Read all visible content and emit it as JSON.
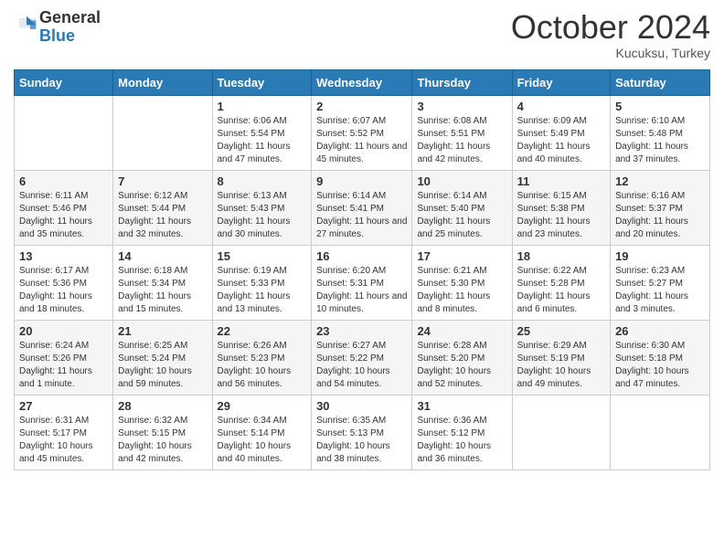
{
  "header": {
    "logo": {
      "general": "General",
      "blue": "Blue"
    },
    "title": "October 2024",
    "location": "Kucuksu, Turkey"
  },
  "weekdays": [
    "Sunday",
    "Monday",
    "Tuesday",
    "Wednesday",
    "Thursday",
    "Friday",
    "Saturday"
  ],
  "weeks": [
    [
      {
        "day": "",
        "sunrise": "",
        "sunset": "",
        "daylight": ""
      },
      {
        "day": "",
        "sunrise": "",
        "sunset": "",
        "daylight": ""
      },
      {
        "day": "1",
        "sunrise": "Sunrise: 6:06 AM",
        "sunset": "Sunset: 5:54 PM",
        "daylight": "Daylight: 11 hours and 47 minutes."
      },
      {
        "day": "2",
        "sunrise": "Sunrise: 6:07 AM",
        "sunset": "Sunset: 5:52 PM",
        "daylight": "Daylight: 11 hours and 45 minutes."
      },
      {
        "day": "3",
        "sunrise": "Sunrise: 6:08 AM",
        "sunset": "Sunset: 5:51 PM",
        "daylight": "Daylight: 11 hours and 42 minutes."
      },
      {
        "day": "4",
        "sunrise": "Sunrise: 6:09 AM",
        "sunset": "Sunset: 5:49 PM",
        "daylight": "Daylight: 11 hours and 40 minutes."
      },
      {
        "day": "5",
        "sunrise": "Sunrise: 6:10 AM",
        "sunset": "Sunset: 5:48 PM",
        "daylight": "Daylight: 11 hours and 37 minutes."
      }
    ],
    [
      {
        "day": "6",
        "sunrise": "Sunrise: 6:11 AM",
        "sunset": "Sunset: 5:46 PM",
        "daylight": "Daylight: 11 hours and 35 minutes."
      },
      {
        "day": "7",
        "sunrise": "Sunrise: 6:12 AM",
        "sunset": "Sunset: 5:44 PM",
        "daylight": "Daylight: 11 hours and 32 minutes."
      },
      {
        "day": "8",
        "sunrise": "Sunrise: 6:13 AM",
        "sunset": "Sunset: 5:43 PM",
        "daylight": "Daylight: 11 hours and 30 minutes."
      },
      {
        "day": "9",
        "sunrise": "Sunrise: 6:14 AM",
        "sunset": "Sunset: 5:41 PM",
        "daylight": "Daylight: 11 hours and 27 minutes."
      },
      {
        "day": "10",
        "sunrise": "Sunrise: 6:14 AM",
        "sunset": "Sunset: 5:40 PM",
        "daylight": "Daylight: 11 hours and 25 minutes."
      },
      {
        "day": "11",
        "sunrise": "Sunrise: 6:15 AM",
        "sunset": "Sunset: 5:38 PM",
        "daylight": "Daylight: 11 hours and 23 minutes."
      },
      {
        "day": "12",
        "sunrise": "Sunrise: 6:16 AM",
        "sunset": "Sunset: 5:37 PM",
        "daylight": "Daylight: 11 hours and 20 minutes."
      }
    ],
    [
      {
        "day": "13",
        "sunrise": "Sunrise: 6:17 AM",
        "sunset": "Sunset: 5:36 PM",
        "daylight": "Daylight: 11 hours and 18 minutes."
      },
      {
        "day": "14",
        "sunrise": "Sunrise: 6:18 AM",
        "sunset": "Sunset: 5:34 PM",
        "daylight": "Daylight: 11 hours and 15 minutes."
      },
      {
        "day": "15",
        "sunrise": "Sunrise: 6:19 AM",
        "sunset": "Sunset: 5:33 PM",
        "daylight": "Daylight: 11 hours and 13 minutes."
      },
      {
        "day": "16",
        "sunrise": "Sunrise: 6:20 AM",
        "sunset": "Sunset: 5:31 PM",
        "daylight": "Daylight: 11 hours and 10 minutes."
      },
      {
        "day": "17",
        "sunrise": "Sunrise: 6:21 AM",
        "sunset": "Sunset: 5:30 PM",
        "daylight": "Daylight: 11 hours and 8 minutes."
      },
      {
        "day": "18",
        "sunrise": "Sunrise: 6:22 AM",
        "sunset": "Sunset: 5:28 PM",
        "daylight": "Daylight: 11 hours and 6 minutes."
      },
      {
        "day": "19",
        "sunrise": "Sunrise: 6:23 AM",
        "sunset": "Sunset: 5:27 PM",
        "daylight": "Daylight: 11 hours and 3 minutes."
      }
    ],
    [
      {
        "day": "20",
        "sunrise": "Sunrise: 6:24 AM",
        "sunset": "Sunset: 5:26 PM",
        "daylight": "Daylight: 11 hours and 1 minute."
      },
      {
        "day": "21",
        "sunrise": "Sunrise: 6:25 AM",
        "sunset": "Sunset: 5:24 PM",
        "daylight": "Daylight: 10 hours and 59 minutes."
      },
      {
        "day": "22",
        "sunrise": "Sunrise: 6:26 AM",
        "sunset": "Sunset: 5:23 PM",
        "daylight": "Daylight: 10 hours and 56 minutes."
      },
      {
        "day": "23",
        "sunrise": "Sunrise: 6:27 AM",
        "sunset": "Sunset: 5:22 PM",
        "daylight": "Daylight: 10 hours and 54 minutes."
      },
      {
        "day": "24",
        "sunrise": "Sunrise: 6:28 AM",
        "sunset": "Sunset: 5:20 PM",
        "daylight": "Daylight: 10 hours and 52 minutes."
      },
      {
        "day": "25",
        "sunrise": "Sunrise: 6:29 AM",
        "sunset": "Sunset: 5:19 PM",
        "daylight": "Daylight: 10 hours and 49 minutes."
      },
      {
        "day": "26",
        "sunrise": "Sunrise: 6:30 AM",
        "sunset": "Sunset: 5:18 PM",
        "daylight": "Daylight: 10 hours and 47 minutes."
      }
    ],
    [
      {
        "day": "27",
        "sunrise": "Sunrise: 6:31 AM",
        "sunset": "Sunset: 5:17 PM",
        "daylight": "Daylight: 10 hours and 45 minutes."
      },
      {
        "day": "28",
        "sunrise": "Sunrise: 6:32 AM",
        "sunset": "Sunset: 5:15 PM",
        "daylight": "Daylight: 10 hours and 42 minutes."
      },
      {
        "day": "29",
        "sunrise": "Sunrise: 6:34 AM",
        "sunset": "Sunset: 5:14 PM",
        "daylight": "Daylight: 10 hours and 40 minutes."
      },
      {
        "day": "30",
        "sunrise": "Sunrise: 6:35 AM",
        "sunset": "Sunset: 5:13 PM",
        "daylight": "Daylight: 10 hours and 38 minutes."
      },
      {
        "day": "31",
        "sunrise": "Sunrise: 6:36 AM",
        "sunset": "Sunset: 5:12 PM",
        "daylight": "Daylight: 10 hours and 36 minutes."
      },
      {
        "day": "",
        "sunrise": "",
        "sunset": "",
        "daylight": ""
      },
      {
        "day": "",
        "sunrise": "",
        "sunset": "",
        "daylight": ""
      }
    ]
  ]
}
